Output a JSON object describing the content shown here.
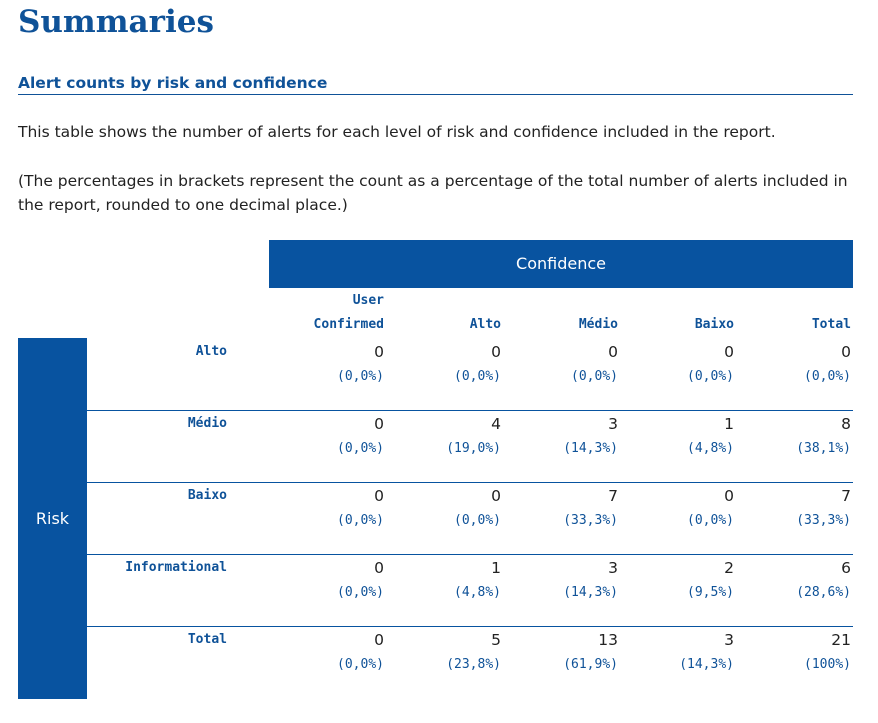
{
  "page": {
    "title": "Summaries",
    "section_heading": "Alert counts by risk and confidence",
    "intro": "This table shows the number of alerts for each level of risk and confidence included in the report.",
    "note": "(The percentages in brackets represent the count as a percentage of the total number of alerts included in the report, rounded to one decimal place.)"
  },
  "table": {
    "confidence_header": "Confidence",
    "risk_header": "Risk",
    "columns": {
      "user_confirmed_line1": "User",
      "user_confirmed_line2": "Confirmed",
      "alto": "Alto",
      "medio": "Médio",
      "baixo": "Baixo",
      "total": "Total"
    },
    "rows": [
      {
        "label": "Alto",
        "counts": [
          "0",
          "0",
          "0",
          "0",
          "0"
        ],
        "pcts": [
          "(0,0%)",
          "(0,0%)",
          "(0,0%)",
          "(0,0%)",
          "(0,0%)"
        ]
      },
      {
        "label": "Médio",
        "counts": [
          "0",
          "4",
          "3",
          "1",
          "8"
        ],
        "pcts": [
          "(0,0%)",
          "(19,0%)",
          "(14,3%)",
          "(4,8%)",
          "(38,1%)"
        ]
      },
      {
        "label": "Baixo",
        "counts": [
          "0",
          "0",
          "7",
          "0",
          "7"
        ],
        "pcts": [
          "(0,0%)",
          "(0,0%)",
          "(33,3%)",
          "(0,0%)",
          "(33,3%)"
        ]
      },
      {
        "label": "Informational",
        "counts": [
          "0",
          "1",
          "3",
          "2",
          "6"
        ],
        "pcts": [
          "(0,0%)",
          "(4,8%)",
          "(14,3%)",
          "(9,5%)",
          "(28,6%)"
        ]
      },
      {
        "label": "Total",
        "counts": [
          "0",
          "5",
          "13",
          "3",
          "21"
        ],
        "pcts": [
          "(0,0%)",
          "(23,8%)",
          "(61,9%)",
          "(14,3%)",
          "(100%)"
        ]
      }
    ]
  },
  "colors": {
    "brand": "#0853a0",
    "text": "#222222",
    "background": "#ffffff"
  }
}
